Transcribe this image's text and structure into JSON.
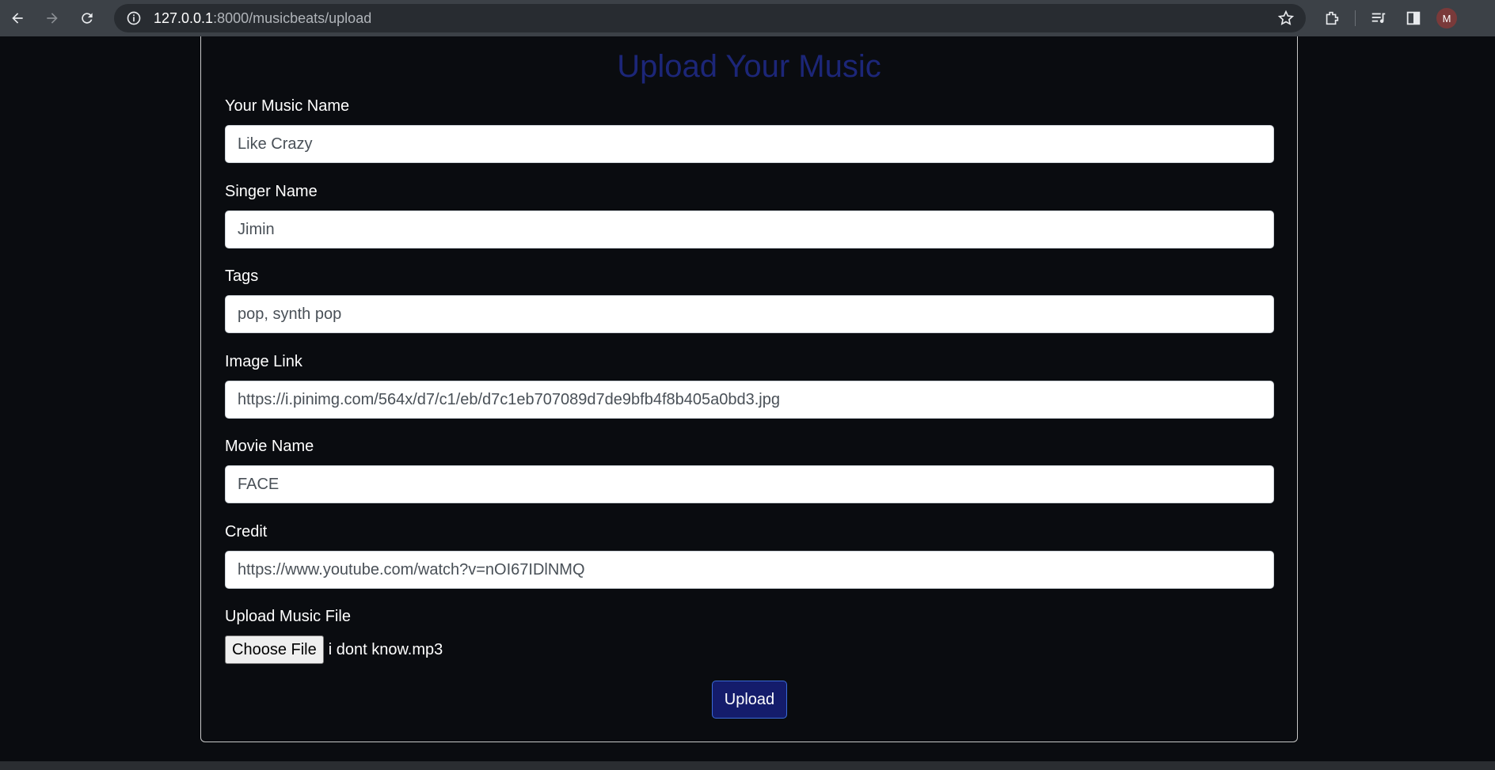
{
  "browser": {
    "url_host": "127.0.0.1",
    "url_path": ":8000/musicbeats/upload",
    "profile_initial": "M"
  },
  "page": {
    "title": "Upload Your Music"
  },
  "form": {
    "music_name": {
      "label": "Your Music Name",
      "value": "Like Crazy"
    },
    "singer_name": {
      "label": "Singer Name",
      "value": "Jimin"
    },
    "tags": {
      "label": "Tags",
      "value": "pop, synth pop"
    },
    "image_link": {
      "label": "Image Link",
      "value": "https://i.pinimg.com/564x/d7/c1/eb/d7c1eb707089d7de9bfb4f8b405a0bd3.jpg"
    },
    "movie_name": {
      "label": "Movie Name",
      "value": "FACE"
    },
    "credit": {
      "label": "Credit",
      "value": "https://www.youtube.com/watch?v=nOI67IDlNMQ"
    },
    "music_file": {
      "label": "Upload Music File",
      "button_label": "Choose File",
      "file_name": "i dont know.mp3"
    },
    "submit_label": "Upload"
  },
  "colors": {
    "title": "#1c2678",
    "upload_button": "#141c6b",
    "background": "#0a0c10"
  }
}
